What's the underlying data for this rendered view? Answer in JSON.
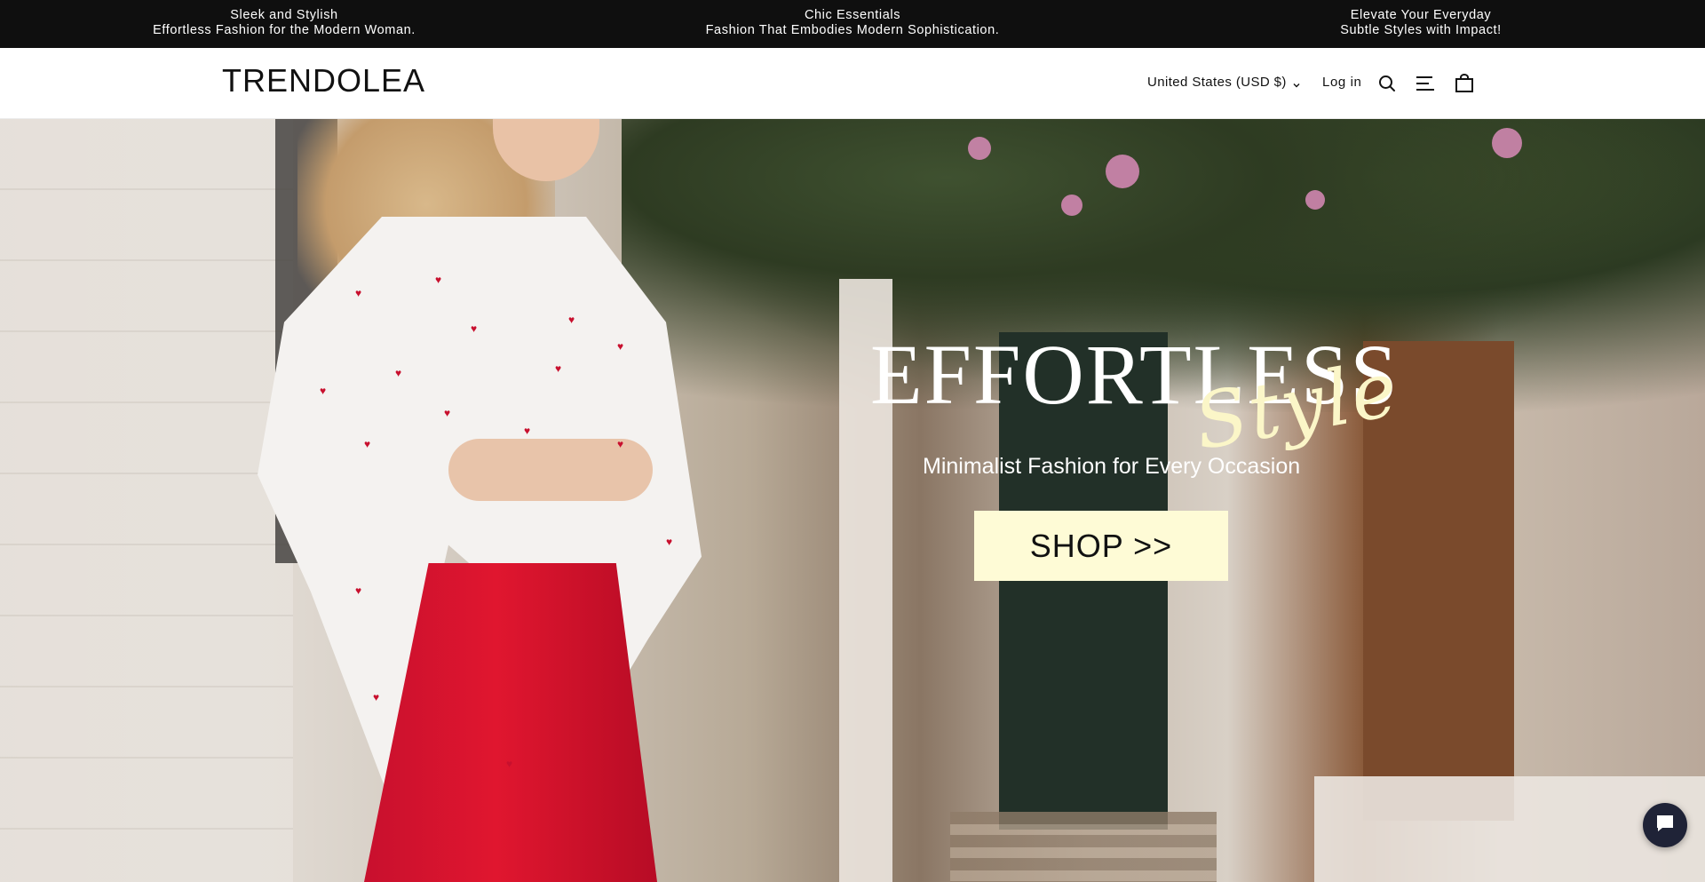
{
  "announcement": {
    "items": [
      {
        "line1": "Sleek and Stylish",
        "line2": "Effortless Fashion for the Modern Woman."
      },
      {
        "line1": "Chic Essentials",
        "line2": "Fashion That Embodies Modern Sophistication."
      },
      {
        "line1": "Elevate Your Everyday",
        "line2": "Subtle Styles with Impact!"
      }
    ],
    "background": "#0f0f0f",
    "text_color": "#ffffff"
  },
  "header": {
    "logo": "TRENDOLEA",
    "currency_selector": "United States (USD $)",
    "login_label": "Log in",
    "icons": [
      "search-icon",
      "menu-icon",
      "shopping-bag-icon",
      "chevron-down-icon"
    ]
  },
  "hero": {
    "title": "EFFORTLESS",
    "script_title": "Style",
    "subtitle": "Minimalist Fashion for Every Occasion",
    "cta_label": "SHOP >>",
    "cta_background": "#fefbd6",
    "script_color": "#fbf6c8"
  },
  "chat_widget": {
    "icon": "chat-bubble-icon",
    "background": "#1f2337"
  }
}
